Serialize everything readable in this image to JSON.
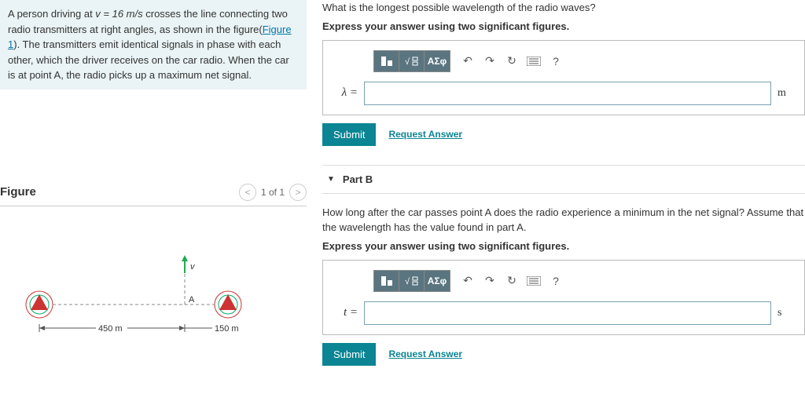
{
  "problem": {
    "text_pre": "A person driving at ",
    "velocity": "v = 16 m/s",
    "text_mid": " crosses the line connecting two radio transmitters at right angles, as shown in the figure(",
    "fig_link": "Figure 1",
    "text_post": "). The transmitters emit identical signals in phase with each other, which the driver receives on the car radio. When the car is at point A, the radio picks up a maximum net signal."
  },
  "figure": {
    "title": "Figure",
    "pager": "1 of 1",
    "dist_left": "450 m",
    "dist_right": "150 m",
    "v_label": "v",
    "a_label": "A"
  },
  "partA": {
    "question": "What is the longest possible wavelength of the radio waves?",
    "instruction": "Express your answer using two significant figures.",
    "var": "λ =",
    "unit": "m",
    "submit": "Submit",
    "request": "Request Answer",
    "tb_greek": "ΑΣφ",
    "tb_help": "?"
  },
  "partB": {
    "header": "Part B",
    "question": "How long after the car passes point A does the radio experience a minimum in the net signal? Assume that the wavelength has the value found in part A.",
    "instruction": "Express your answer using two significant figures.",
    "var": "t =",
    "unit": "s",
    "submit": "Submit",
    "request": "Request Answer",
    "tb_greek": "ΑΣφ",
    "tb_help": "?"
  }
}
